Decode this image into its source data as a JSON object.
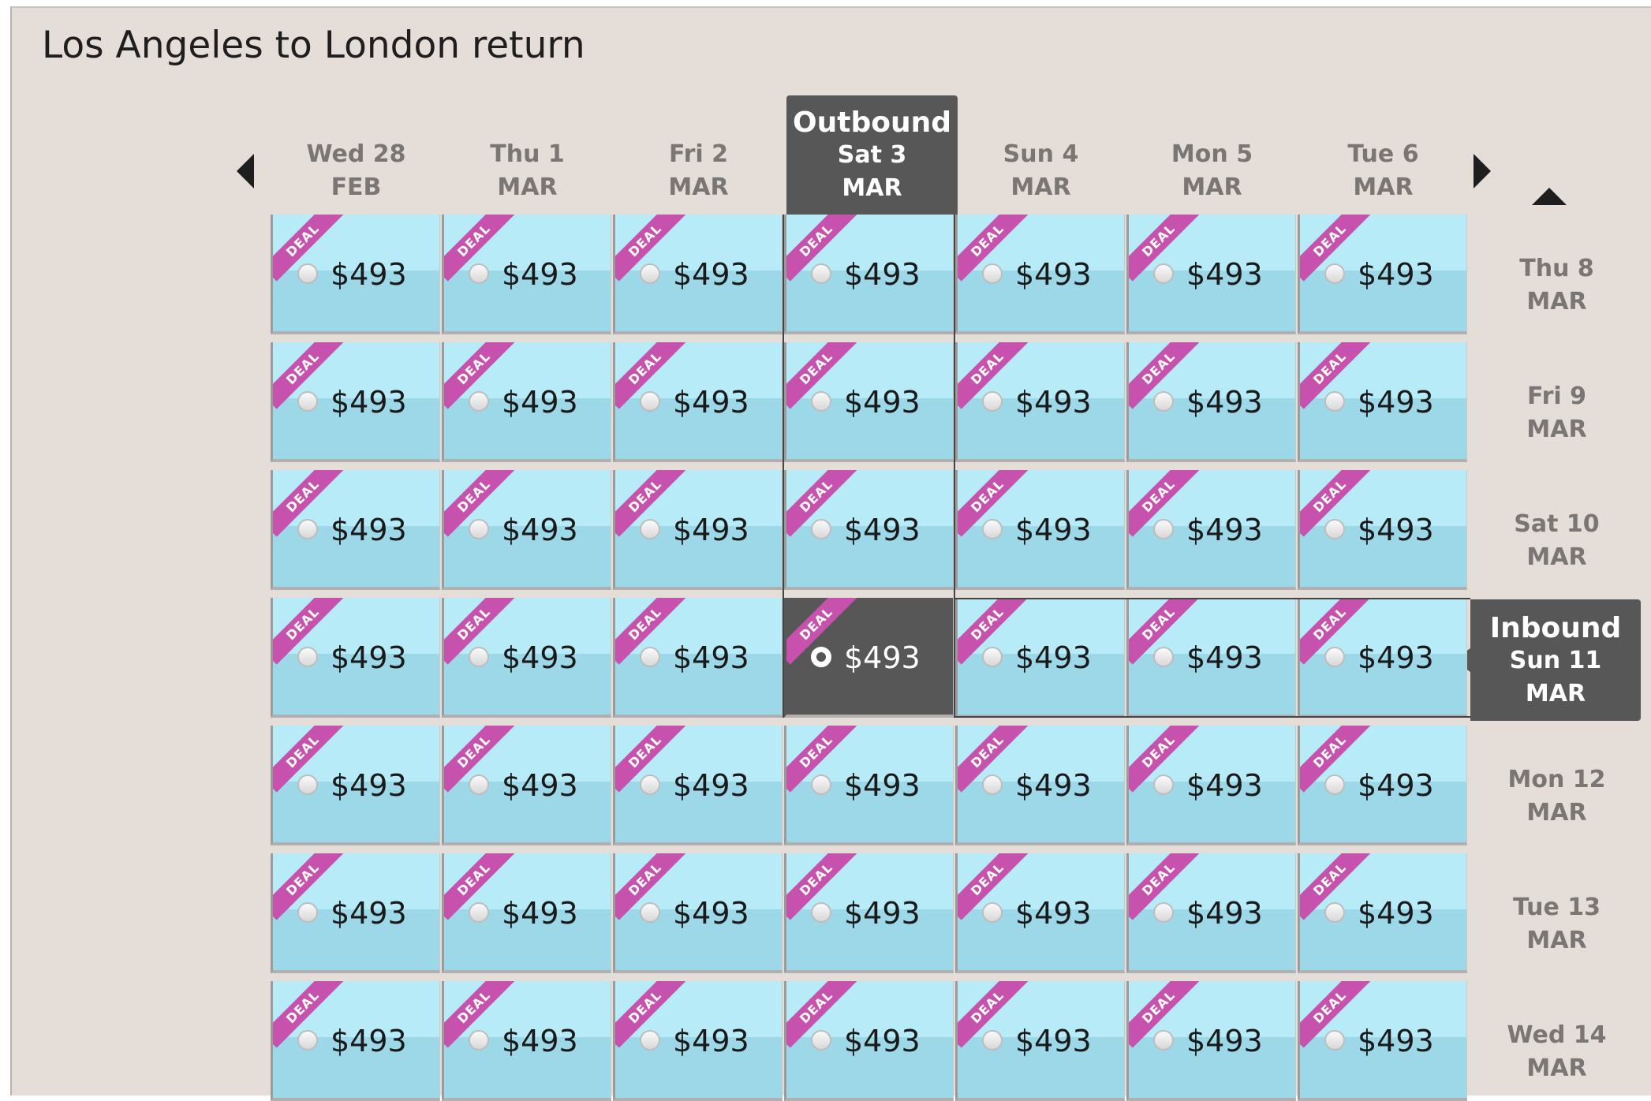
{
  "title": "Los Angeles to London return",
  "nav": {
    "prev_icon": "caret-left-icon",
    "next_icon": "caret-right-icon",
    "up_icon": "caret-up-icon"
  },
  "outbound": {
    "label": "Outbound",
    "selected_day": "Sat 3",
    "selected_month": "MAR",
    "selected_index": 3
  },
  "inbound": {
    "label": "Inbound",
    "selected_day": "Sun 11",
    "selected_month": "MAR",
    "selected_index": 3
  },
  "columns": [
    {
      "day": "Wed 28",
      "month": "FEB"
    },
    {
      "day": "Thu 1",
      "month": "MAR"
    },
    {
      "day": "Fri 2",
      "month": "MAR"
    },
    {
      "day": "Sat 3",
      "month": "MAR"
    },
    {
      "day": "Sun 4",
      "month": "MAR"
    },
    {
      "day": "Mon 5",
      "month": "MAR"
    },
    {
      "day": "Tue 6",
      "month": "MAR"
    }
  ],
  "rows": [
    {
      "day": "Thu 8",
      "month": "MAR"
    },
    {
      "day": "Fri 9",
      "month": "MAR"
    },
    {
      "day": "Sat 10",
      "month": "MAR"
    },
    {
      "day": "Sun 11",
      "month": "MAR"
    },
    {
      "day": "Mon 12",
      "month": "MAR"
    },
    {
      "day": "Tue 13",
      "month": "MAR"
    },
    {
      "day": "Wed 14",
      "month": "MAR"
    }
  ],
  "deal_label": "DEAL",
  "prices": [
    [
      "$493",
      "$493",
      "$493",
      "$493",
      "$493",
      "$493",
      "$493"
    ],
    [
      "$493",
      "$493",
      "$493",
      "$493",
      "$493",
      "$493",
      "$493"
    ],
    [
      "$493",
      "$493",
      "$493",
      "$493",
      "$493",
      "$493",
      "$493"
    ],
    [
      "$493",
      "$493",
      "$493",
      "$493",
      "$493",
      "$493",
      "$493"
    ],
    [
      "$493",
      "$493",
      "$493",
      "$493",
      "$493",
      "$493",
      "$493"
    ],
    [
      "$493",
      "$493",
      "$493",
      "$493",
      "$493",
      "$493",
      "$493"
    ],
    [
      "$493",
      "$493",
      "$493",
      "$493",
      "$493",
      "$493",
      "$493"
    ]
  ],
  "colors": {
    "cell_top": "#b6ebf7",
    "cell_bottom": "#9dd8e8",
    "selected": "#575757",
    "deal_ribbon": "#c752ad",
    "panel_bg": "#e4ddd8"
  }
}
